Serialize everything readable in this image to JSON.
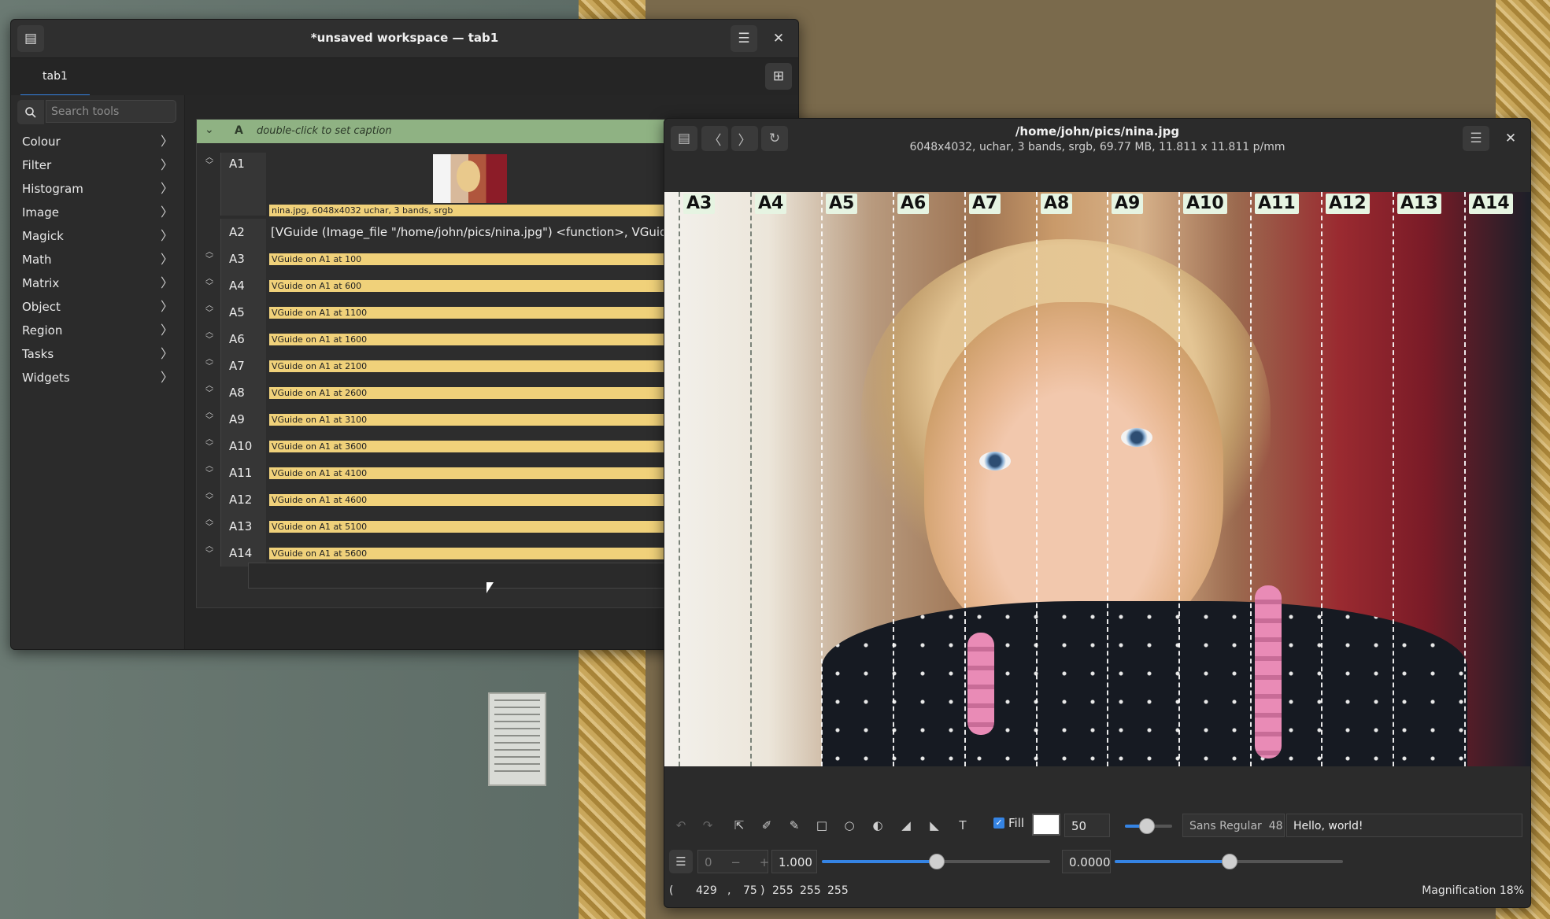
{
  "workspace": {
    "title": "*unsaved workspace — tab1",
    "tab": "tab1",
    "search_placeholder": "Search tools",
    "menu": [
      "Colour",
      "Filter",
      "Histogram",
      "Image",
      "Magick",
      "Math",
      "Matrix",
      "Object",
      "Region",
      "Tasks",
      "Widgets"
    ],
    "column": {
      "letter": "A",
      "caption": "double-click to set caption",
      "a1": {
        "name": "A1",
        "info": "nina.jpg, 6048x4032 uchar, 3 bands, srgb"
      },
      "a2": {
        "name": "A2",
        "text": "[VGuide (Image_file \"/home/john/pics/nina.jpg\") <function>, VGuide (Image_fi"
      },
      "rows": [
        {
          "name": "A3",
          "text": "VGuide on A1 at 100"
        },
        {
          "name": "A4",
          "text": "VGuide on A1 at 600"
        },
        {
          "name": "A5",
          "text": "VGuide on A1 at 1100"
        },
        {
          "name": "A6",
          "text": "VGuide on A1 at 1600"
        },
        {
          "name": "A7",
          "text": "VGuide on A1 at 2100"
        },
        {
          "name": "A8",
          "text": "VGuide on A1 at 2600"
        },
        {
          "name": "A9",
          "text": "VGuide on A1 at 3100"
        },
        {
          "name": "A10",
          "text": "VGuide on A1 at 3600"
        },
        {
          "name": "A11",
          "text": "VGuide on A1 at 4100"
        },
        {
          "name": "A12",
          "text": "VGuide on A1 at 4600"
        },
        {
          "name": "A13",
          "text": "VGuide on A1 at 5100"
        },
        {
          "name": "A14",
          "text": "VGuide on A1 at 5600"
        }
      ]
    }
  },
  "viewer": {
    "title": "/home/john/pics/nina.jpg",
    "subtitle": "6048x4032,  uchar, 3 bands, srgb, 69.77 MB, 11.811 x 11.811 p/mm",
    "guides": [
      "A3",
      "A4",
      "A5",
      "A6",
      "A7",
      "A8",
      "A9",
      "A10",
      "A11",
      "A12",
      "A13",
      "A14"
    ],
    "fill_label": "Fill",
    "fill_checked": true,
    "brush_size": "50",
    "font": "Sans Regular",
    "font_size": "48",
    "text_value": "Hello, world!",
    "page_value": "0",
    "scale": "1.000",
    "offset": "0.0000",
    "status": {
      "x": "429",
      "y": "75",
      "r": "255",
      "g": "255",
      "b": "255",
      "magnification": "Magnification 18%"
    }
  },
  "icons": {
    "menu": "hamburger-icon",
    "close": "close-icon",
    "search": "search-icon"
  },
  "colors": {
    "accent": "#3584e4",
    "column_header": "#8fb283",
    "row_highlight": "#f0d17a"
  }
}
